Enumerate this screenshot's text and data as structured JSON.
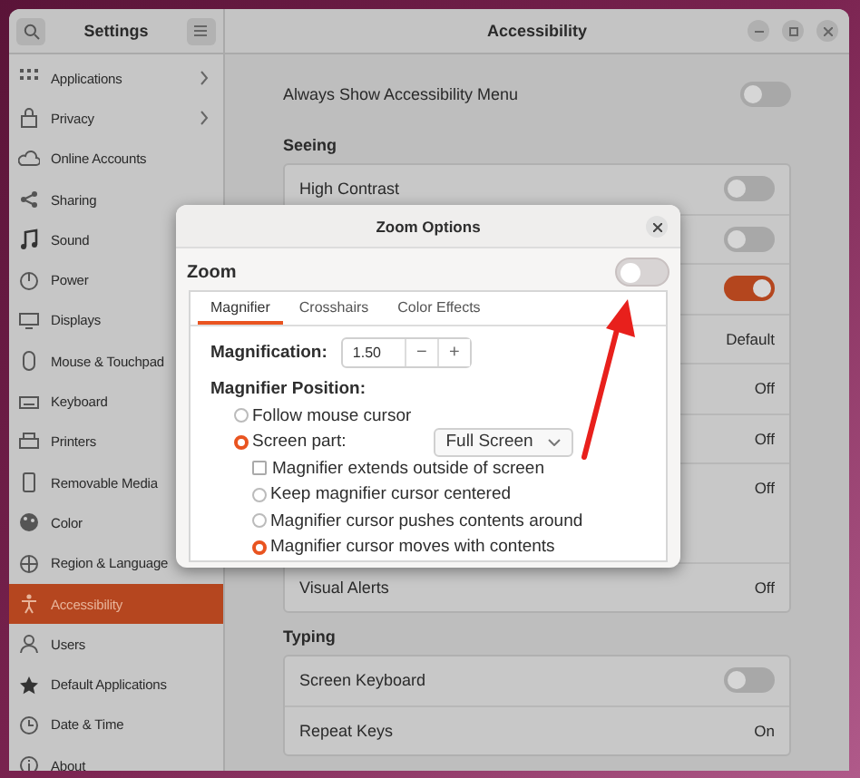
{
  "sidebar": {
    "title": "Settings",
    "items": [
      {
        "label": "Applications",
        "submenu": true,
        "selected": false
      },
      {
        "label": "Privacy",
        "submenu": true,
        "selected": false
      },
      {
        "label": "Online Accounts",
        "submenu": false,
        "selected": false
      },
      {
        "label": "Sharing",
        "submenu": false,
        "selected": false
      },
      {
        "label": "Sound",
        "submenu": false,
        "selected": false
      },
      {
        "label": "Power",
        "submenu": false,
        "selected": false
      },
      {
        "label": "Displays",
        "submenu": false,
        "selected": false
      },
      {
        "label": "Mouse & Touchpad",
        "submenu": false,
        "selected": false
      },
      {
        "label": "Keyboard",
        "submenu": false,
        "selected": false
      },
      {
        "label": "Printers",
        "submenu": false,
        "selected": false
      },
      {
        "label": "Removable Media",
        "submenu": false,
        "selected": false
      },
      {
        "label": "Color",
        "submenu": false,
        "selected": false
      },
      {
        "label": "Region & Language",
        "submenu": false,
        "selected": false
      },
      {
        "label": "Accessibility",
        "submenu": false,
        "selected": true
      },
      {
        "label": "Users",
        "submenu": false,
        "selected": false
      },
      {
        "label": "Default Applications",
        "submenu": false,
        "selected": false
      },
      {
        "label": "Date & Time",
        "submenu": false,
        "selected": false
      },
      {
        "label": "About",
        "submenu": false,
        "selected": false
      }
    ]
  },
  "header": {
    "title": "Accessibility"
  },
  "always_show": {
    "label": "Always Show Accessibility Menu",
    "on": false
  },
  "sections": [
    {
      "heading": "Seeing",
      "rows": [
        {
          "kind": "toggle",
          "label": "High Contrast",
          "on": false
        },
        {
          "kind": "toggle",
          "on": false
        },
        {
          "kind": "toggle",
          "on": true
        },
        {
          "kind": "value",
          "value": "Default"
        },
        {
          "kind": "value",
          "value": "Off"
        },
        {
          "kind": "value",
          "value": "Off"
        },
        {
          "kind": "value",
          "value": "Off"
        },
        {
          "kind": "value",
          "label": "Visual Alerts",
          "value": "Off"
        }
      ]
    },
    {
      "heading": "Typing",
      "rows": [
        {
          "kind": "toggle",
          "label": "Screen Keyboard",
          "on": false
        },
        {
          "kind": "value",
          "label": "Repeat Keys",
          "value": "On"
        }
      ]
    }
  ],
  "dialog": {
    "title": "Zoom Options",
    "zoom": {
      "label": "Zoom",
      "on": false
    },
    "tabs": [
      {
        "label": "Magnifier",
        "selected": true
      },
      {
        "label": "Crosshairs",
        "selected": false
      },
      {
        "label": "Color Effects",
        "selected": false
      }
    ],
    "magnification": {
      "label": "Magnification:",
      "value": "1.50",
      "minus": "−",
      "plus": "+"
    },
    "position": {
      "heading": "Magnifier Position:",
      "options": [
        {
          "kind": "radio",
          "label": "Follow mouse cursor",
          "selected": false
        },
        {
          "kind": "radio",
          "label": "Screen part:",
          "selected": true,
          "dropdown": "Full Screen"
        },
        {
          "kind": "checkbox",
          "label": "Magnifier extends outside of screen",
          "checked": false
        },
        {
          "kind": "radio",
          "label": "Keep magnifier cursor centered",
          "selected": false
        },
        {
          "kind": "radio",
          "label": "Magnifier cursor pushes contents around",
          "selected": false
        },
        {
          "kind": "radio",
          "label": "Magnifier cursor moves with contents",
          "selected": true
        }
      ]
    }
  }
}
